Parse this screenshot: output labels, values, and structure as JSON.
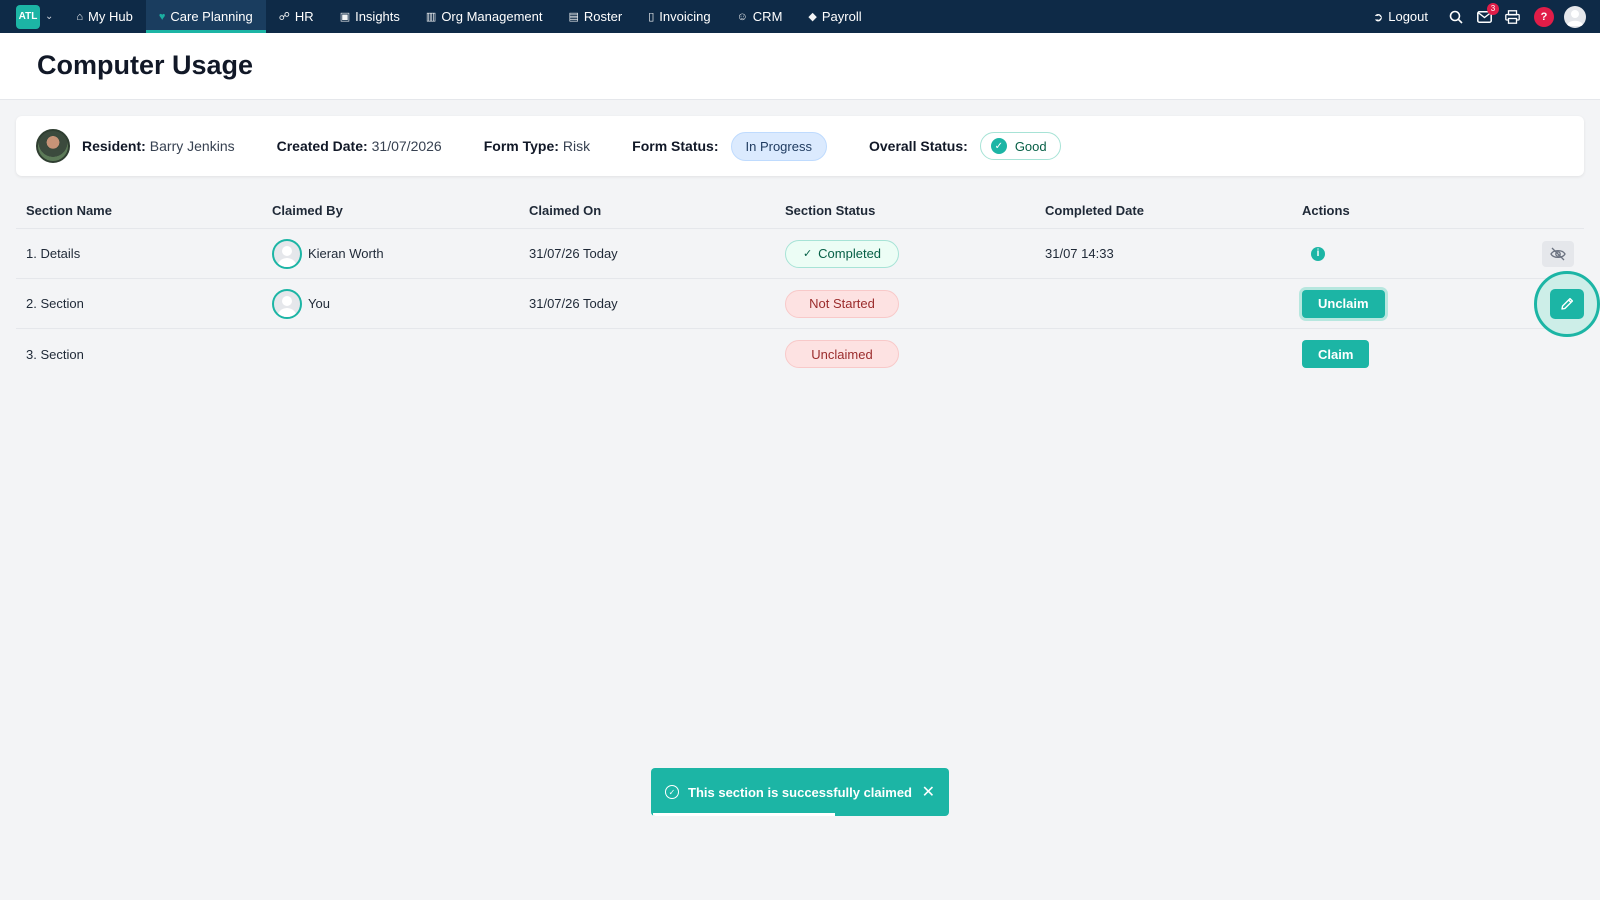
{
  "brand": {
    "logo_text": "ATL"
  },
  "nav": {
    "items": [
      {
        "label": "My Hub",
        "icon": "home-icon",
        "glyph": "⌂"
      },
      {
        "label": "Care Planning",
        "icon": "heart-icon",
        "glyph": "♥"
      },
      {
        "label": "HR",
        "icon": "people-icon",
        "glyph": "☍"
      },
      {
        "label": "Insights",
        "icon": "chart-icon",
        "glyph": "▣"
      },
      {
        "label": "Org Management",
        "icon": "building-icon",
        "glyph": "▥"
      },
      {
        "label": "Roster",
        "icon": "calendar-icon",
        "glyph": "▤"
      },
      {
        "label": "Invoicing",
        "icon": "invoice-icon",
        "glyph": "▯"
      },
      {
        "label": "CRM",
        "icon": "contacts-icon",
        "glyph": "☺"
      },
      {
        "label": "Payroll",
        "icon": "tag-icon",
        "glyph": "◆"
      }
    ],
    "active": "Care Planning",
    "logout_label": "Logout",
    "mail_count": "3",
    "help_label": "?"
  },
  "page": {
    "title": "Computer Usage"
  },
  "info": {
    "resident_label": "Resident:",
    "resident_value": "Barry Jenkins",
    "created_label": "Created Date:",
    "created_value": "31/07/2026",
    "form_type_label": "Form Type:",
    "form_type_value": "Risk",
    "form_status_label": "Form Status:",
    "form_status_value": "In Progress",
    "overall_label": "Overall Status:",
    "overall_value": "Good"
  },
  "table": {
    "headers": [
      "Section Name",
      "Claimed By",
      "Claimed On",
      "Section Status",
      "Completed Date",
      "Actions"
    ],
    "rows": [
      {
        "name": "1. Details",
        "claimed_by": "Kieran Worth",
        "claimed_on": "31/07/26 Today",
        "status": "Completed",
        "completed": "31/07 14:33",
        "action": ""
      },
      {
        "name": "2. Section",
        "claimed_by": "You",
        "claimed_on": "31/07/26 Today",
        "status": "Not Started",
        "completed": "",
        "action": "Unclaim"
      },
      {
        "name": "3. Section",
        "claimed_by": "",
        "claimed_on": "",
        "status": "Unclaimed",
        "completed": "",
        "action": "Claim"
      }
    ]
  },
  "toast": {
    "message": "This section is successfully claimed",
    "progress": 0.61
  },
  "colors": {
    "nav_bg": "#0e2a47",
    "accent": "#1cb5a5",
    "danger": "#e11d48"
  }
}
